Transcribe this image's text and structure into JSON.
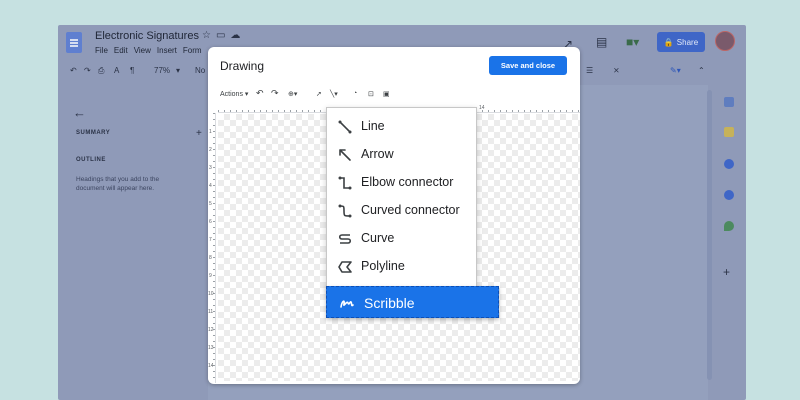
{
  "docs": {
    "title": "Electronic Signatures",
    "menus": [
      "File",
      "Edit",
      "View",
      "Insert",
      "Form"
    ],
    "zoom": "77%",
    "style_partial": "No",
    "share_label": "Share",
    "outline": {
      "summary_label": "SUMMARY",
      "outline_label": "OUTLINE",
      "hint": "Headings that you add to the document will appear here."
    }
  },
  "dialog": {
    "title": "Drawing",
    "save_close": "Save and close",
    "actions_label": "Actions",
    "ruler_left_numbers": [
      "1",
      "2",
      "3",
      "4",
      "5",
      "6",
      "7",
      "8",
      "9",
      "10",
      "11",
      "12",
      "13",
      "14"
    ],
    "ruler_top_number": "14"
  },
  "line_menu": {
    "items": [
      {
        "label": "Line",
        "icon": "line-icon"
      },
      {
        "label": "Arrow",
        "icon": "arrow-icon"
      },
      {
        "label": "Elbow connector",
        "icon": "elbow-connector-icon"
      },
      {
        "label": "Curved connector",
        "icon": "curved-connector-icon"
      },
      {
        "label": "Curve",
        "icon": "curve-icon"
      },
      {
        "label": "Polyline",
        "icon": "polyline-icon"
      }
    ],
    "highlighted": {
      "label": "Scribble",
      "icon": "scribble-icon"
    }
  },
  "colors": {
    "accent": "#1a73e8",
    "backdrop": "#c6e1e1",
    "dim_frame": "#8f9ab8"
  }
}
